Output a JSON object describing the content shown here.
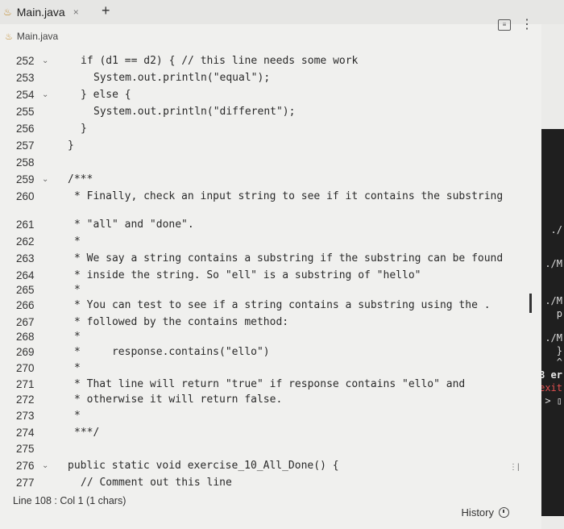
{
  "tab": {
    "name": "Main.java",
    "close": "×",
    "add": "+"
  },
  "breadcrumb": {
    "file": "Main.java"
  },
  "toolbar": {
    "preview_icon": "preview-box-icon",
    "more": "⋮"
  },
  "code_lines": [
    {
      "ln": "252",
      "fold": true,
      "indent": 100,
      "text": "if (d1 == d2) { // this line needs some work"
    },
    {
      "ln": "253",
      "fold": false,
      "indent": 116,
      "text": "System.out.println(\"equal\");"
    },
    {
      "ln": "254",
      "fold": true,
      "indent": 100,
      "text": "} else {"
    },
    {
      "ln": "255",
      "fold": false,
      "indent": 116,
      "text": "System.out.println(\"different\");"
    },
    {
      "ln": "256",
      "fold": false,
      "indent": 100,
      "text": "}"
    },
    {
      "ln": "257",
      "fold": false,
      "indent": 84,
      "text": "}"
    },
    {
      "ln": "258",
      "fold": false,
      "indent": 84,
      "text": ""
    },
    {
      "ln": "259",
      "fold": true,
      "indent": 84,
      "text": "/***"
    },
    {
      "ln": "260",
      "fold": false,
      "indent": 92,
      "text": "* Finally, check an input string to see if it contains the substring"
    },
    {
      "ln": "261",
      "fold": false,
      "indent": 92,
      "text": "* \"all\" and \"done\"."
    },
    {
      "ln": "262",
      "fold": false,
      "indent": 92,
      "text": "*"
    },
    {
      "ln": "263",
      "fold": false,
      "indent": 92,
      "text": "* We say a string contains a substring if the substring can be found"
    },
    {
      "ln": "264",
      "fold": false,
      "indent": 92,
      "text": "* inside the string. So \"ell\" is a substring of \"hello\""
    },
    {
      "ln": "265",
      "fold": false,
      "indent": 92,
      "text": "*"
    },
    {
      "ln": "266",
      "fold": false,
      "indent": 92,
      "text": "* You can test to see if a string contains a substring using the ."
    },
    {
      "ln": "267",
      "fold": false,
      "indent": 92,
      "text": "* followed by the contains method:"
    },
    {
      "ln": "268",
      "fold": false,
      "indent": 92,
      "text": "*"
    },
    {
      "ln": "269",
      "fold": false,
      "indent": 92,
      "text": "*     response.contains(\"ello\")"
    },
    {
      "ln": "270",
      "fold": false,
      "indent": 92,
      "text": "*"
    },
    {
      "ln": "271",
      "fold": false,
      "indent": 92,
      "text": "* That line will return \"true\" if response contains \"ello\" and"
    },
    {
      "ln": "272",
      "fold": false,
      "indent": 92,
      "text": "* otherwise it will return false."
    },
    {
      "ln": "273",
      "fold": false,
      "indent": 92,
      "text": "*"
    },
    {
      "ln": "274",
      "fold": false,
      "indent": 92,
      "text": "***/"
    },
    {
      "ln": "275",
      "fold": false,
      "indent": 84,
      "text": ""
    },
    {
      "ln": "276",
      "fold": true,
      "indent": 84,
      "text": "public static void exercise_10_All_Done() {"
    },
    {
      "ln": "277",
      "fold": false,
      "indent": 100,
      "text": "// Comment out this line"
    }
  ],
  "status": {
    "position": "Line 108 : Col 1 (1 chars)",
    "history": "History"
  },
  "console_fragments": [
    {
      "text": "./",
      "cls": ""
    },
    {
      "text": "./M",
      "cls": ""
    },
    {
      "text": "./M",
      "cls": ""
    },
    {
      "text": "p",
      "cls": ""
    },
    {
      "text": "./M",
      "cls": ""
    },
    {
      "text": "}",
      "cls": ""
    },
    {
      "text": "^",
      "cls": ""
    },
    {
      "text": "8 er",
      "cls": "err"
    },
    {
      "text": "exit",
      "cls": "red"
    },
    {
      "text": "> ▯",
      "cls": ""
    }
  ]
}
